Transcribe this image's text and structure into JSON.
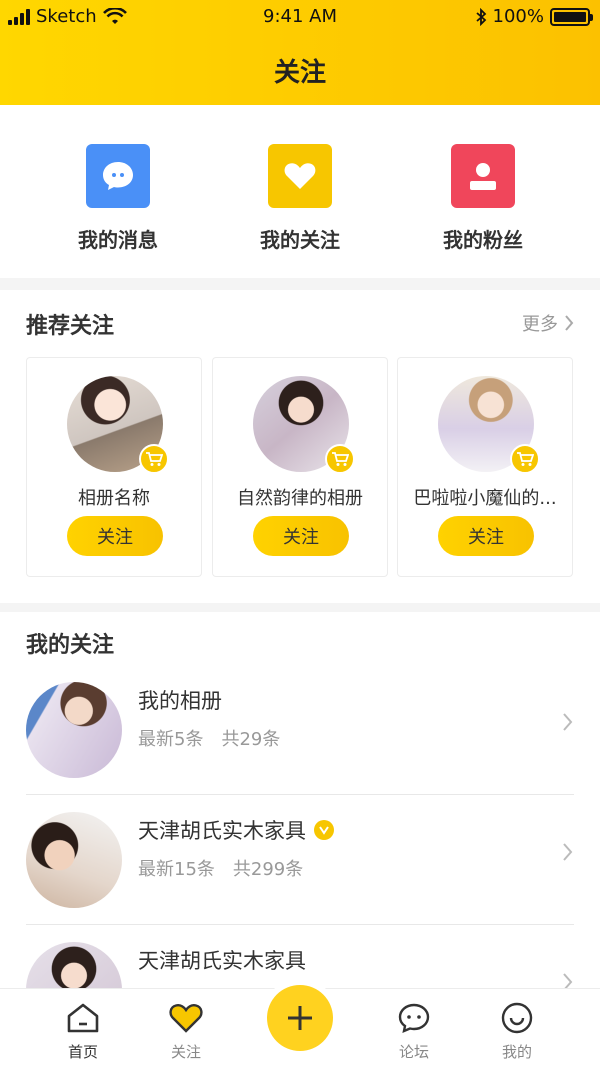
{
  "status": {
    "carrier": "Sketch",
    "time": "9:41 AM",
    "battery": "100%",
    "battery_level": 1.0
  },
  "header": {
    "title": "关注"
  },
  "quick_actions": [
    {
      "label": "我的消息",
      "icon": "chat-bubble-icon",
      "color": "#4a90f7"
    },
    {
      "label": "我的关注",
      "icon": "heart-icon",
      "color": "#f7c600"
    },
    {
      "label": "我的粉丝",
      "icon": "user-icon",
      "color": "#f0465b"
    }
  ],
  "recommended": {
    "title": "推荐关注",
    "more": "更多",
    "cards": [
      {
        "name": "相册名称",
        "button": "关注"
      },
      {
        "name": "自然韵律的相册",
        "button": "关注"
      },
      {
        "name": "巴啦啦小魔仙的...",
        "button": "关注"
      }
    ]
  },
  "my_follows": {
    "title": "我的关注",
    "rows": [
      {
        "name": "我的相册",
        "latest": "最新5条",
        "total": "共29条",
        "verified": false
      },
      {
        "name": "天津胡氏实木家具",
        "latest": "最新15条",
        "total": "共299条",
        "verified": true
      },
      {
        "name": "天津胡氏实木家具",
        "latest": "",
        "total": "",
        "verified": false
      }
    ]
  },
  "tabbar": {
    "items": [
      {
        "label": "首页",
        "icon": "home-icon",
        "active": true
      },
      {
        "label": "关注",
        "icon": "heart-icon",
        "active": false
      },
      {
        "label": "论坛",
        "icon": "forum-icon",
        "active": false
      },
      {
        "label": "我的",
        "icon": "profile-icon",
        "active": false
      }
    ],
    "center_icon": "plus-icon"
  },
  "colors": {
    "brand_yellow": "#ffd200",
    "blue": "#4a90f7",
    "red": "#f0465b"
  }
}
